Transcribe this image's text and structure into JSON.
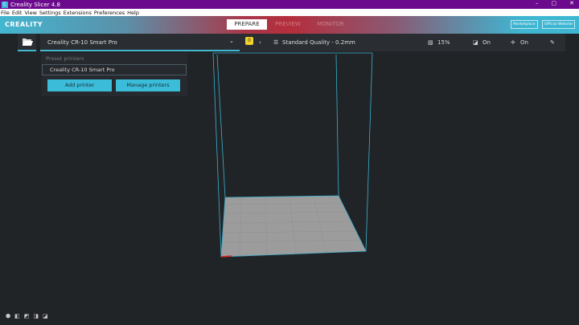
{
  "window": {
    "title": "Creality Slicer 4.8",
    "minimize": "–",
    "restore": "▢",
    "close": "✕"
  },
  "menu": [
    "File",
    "Edit",
    "View",
    "Settings",
    "Extensions",
    "Preferences",
    "Help"
  ],
  "header": {
    "logo": "CREALITY",
    "tabs": [
      "PREPARE",
      "PREVIEW",
      "MONITOR"
    ],
    "active_tab": "PREPARE",
    "marketplace": "Marketplace",
    "official_website": "Official Website"
  },
  "toolbar": {
    "printer": "Creality CR-10 Smart Pro",
    "notification_count": "0",
    "profile": "Standard Quality - 0.2mm",
    "infill": "15%",
    "support": "On",
    "adhesion": "On"
  },
  "dropdown": {
    "section": "Preset printers",
    "item": "Creality CR-10 Smart Pro",
    "add_printer": "Add printer",
    "manage_printers": "Manage printers"
  },
  "colors": {
    "accent": "#3bbcd9",
    "titlebar": "#6b0a8c",
    "viewport": "#212427",
    "buildplate": "#9a9a9a"
  }
}
